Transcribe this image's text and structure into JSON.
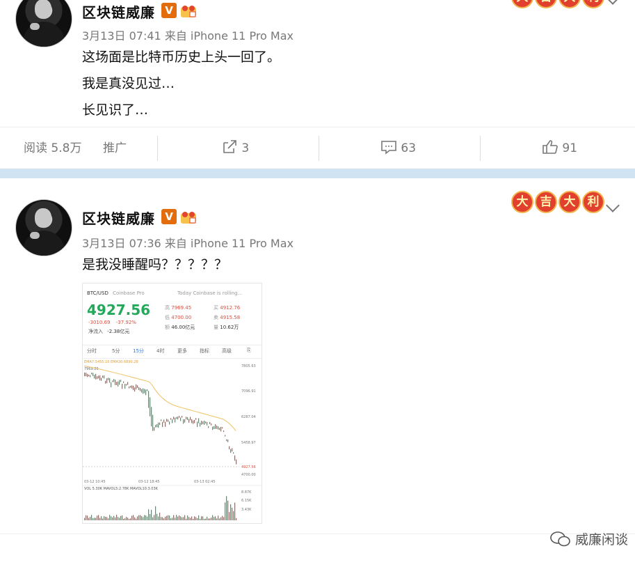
{
  "post1": {
    "username": "区块链威廉",
    "badge": "V",
    "meta": "3月13日 07:41 来自 iPhone 11 Pro Max",
    "lines": [
      "这场面是比特币历史上头一回了。",
      "我是真没见过…",
      "长见识了…"
    ],
    "actions": {
      "read": "阅读 5.8万",
      "promote": "推广",
      "share_count": "3",
      "comment_count": "63",
      "like_count": "91"
    }
  },
  "post2": {
    "username": "区块链威廉",
    "badge": "V",
    "meta": "3月13日 07:36 来自 iPhone 11 Pro Max",
    "text": "是我没睡醒吗？？？？？",
    "lucky": [
      "大",
      "吉",
      "大",
      "利"
    ],
    "image": {
      "pair": "BTC/USD",
      "exchange": "Coinbase Pro",
      "notice": "Today Coinbase is rolling...",
      "price": "4927.56",
      "change": "-3010.69",
      "change_pct": "-37.92%",
      "netflow_label": "净流入",
      "netflow": "-2.38亿元",
      "high_label": "高",
      "high": "7969.45",
      "low_label": "低",
      "low": "4700.00",
      "amount_label": "额",
      "amount": "46.00亿元",
      "buy_label": "买",
      "buy": "4912.76",
      "sell_label": "卖",
      "sell": "4915.58",
      "vol_label": "量",
      "vol": "10.62万",
      "tabs": [
        "分时",
        "5分",
        "15分",
        "4时",
        "更多",
        "指标",
        "高级"
      ],
      "y_ticks": [
        "7805.63",
        "7096.91",
        "6287.04",
        "5458.97",
        "4927.56",
        "4700.00"
      ],
      "x_ticks": [
        "03-12 10:45",
        "03-12 18:45",
        "03-13 02:45"
      ],
      "vol_ticks": [
        "8.87K",
        "6.15K",
        "3.43K"
      ],
      "ema_label": "EMA7:5455.16 EMA30:6890.28",
      "vol_label2": "VOL 5.30K MAVOL5:2.78K MAVOL10:3.03K",
      "first_label": "7969.26"
    }
  },
  "watermark": "威廉闲谈"
}
